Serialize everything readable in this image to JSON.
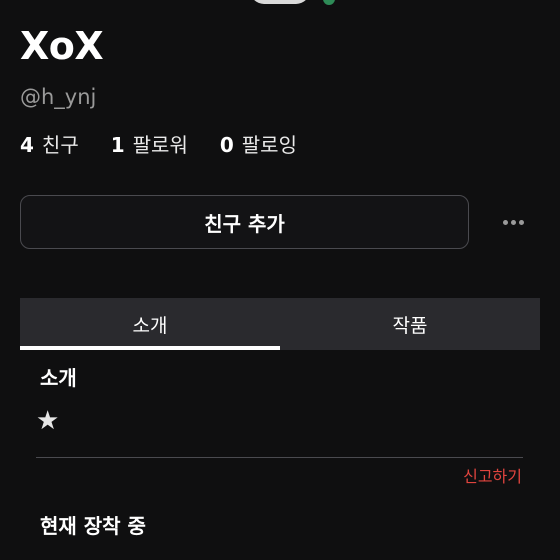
{
  "profile": {
    "display_name": "XoX",
    "handle": "@h_ynj"
  },
  "stats": [
    {
      "count": "4",
      "label": "친구"
    },
    {
      "count": "1",
      "label": "팔로워"
    },
    {
      "count": "0",
      "label": "팔로잉"
    }
  ],
  "actions": {
    "add_friend_label": "친구 추가",
    "more_icon": "more-horizontal-icon"
  },
  "tabs": [
    {
      "label": "소개",
      "active": true
    },
    {
      "label": "작품",
      "active": false
    }
  ],
  "intro": {
    "heading": "소개",
    "body": "★"
  },
  "report_label": "신고하기",
  "equipped": {
    "heading": "현재 장착 중"
  },
  "colors": {
    "background": "#0f0f10",
    "report": "#e0443e",
    "online": "#2e8b57",
    "tab_bar": "#2a2a2e"
  }
}
